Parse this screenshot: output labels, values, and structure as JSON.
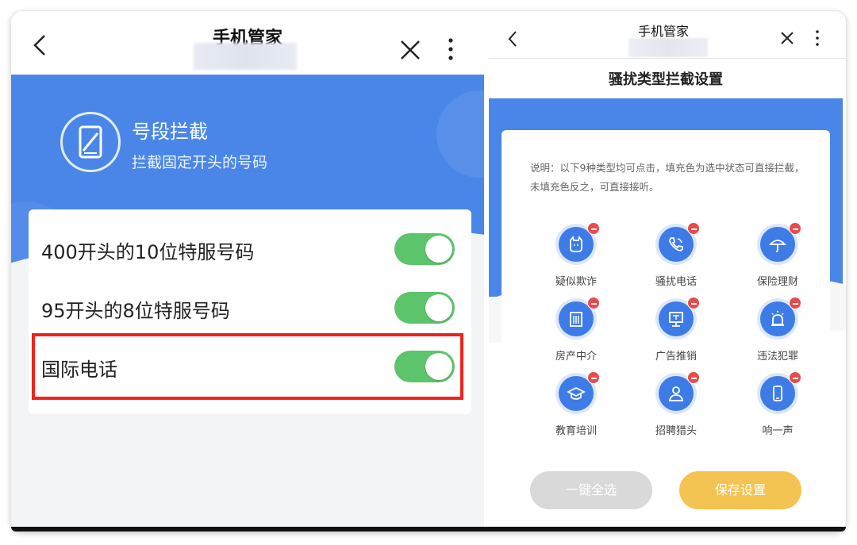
{
  "left": {
    "nav": {
      "title": "手机管家"
    },
    "banner": {
      "title": "号段拦截",
      "subtitle": "拦截固定开头的号码"
    },
    "rows": [
      {
        "label": "400开头的10位特服号码",
        "enabled": true
      },
      {
        "label": "95开头的8位特服号码",
        "enabled": true
      },
      {
        "label": "国际电话",
        "enabled": true
      }
    ]
  },
  "right": {
    "nav": {
      "title": "手机管家"
    },
    "page_title": "骚扰类型拦截设置",
    "description": "说明：以下9种类型均可点击，填充色为选中状态可直接拦截，未填充色反之，可直接接听。",
    "categories": [
      {
        "name": "疑似欺诈",
        "icon": "face-icon"
      },
      {
        "name": "骚扰电话",
        "icon": "phone-icon"
      },
      {
        "name": "保险理财",
        "icon": "umbrella-icon"
      },
      {
        "name": "房产中介",
        "icon": "building-icon"
      },
      {
        "name": "广告推销",
        "icon": "billboard-icon"
      },
      {
        "name": "违法犯罪",
        "icon": "alarm-icon"
      },
      {
        "name": "教育培训",
        "icon": "graduation-cap-icon"
      },
      {
        "name": "招聘猎头",
        "icon": "person-icon"
      },
      {
        "name": "响一声",
        "icon": "mobile-icon"
      }
    ],
    "buttons": {
      "select_all": "一键全选",
      "save": "保存设置"
    }
  },
  "colors": {
    "primary_blue": "#4a86e8",
    "toggle_on": "#5cc46a",
    "highlight_red": "#f0231b",
    "badge_red": "#e84b4b",
    "save_yellow": "#f3c451"
  }
}
